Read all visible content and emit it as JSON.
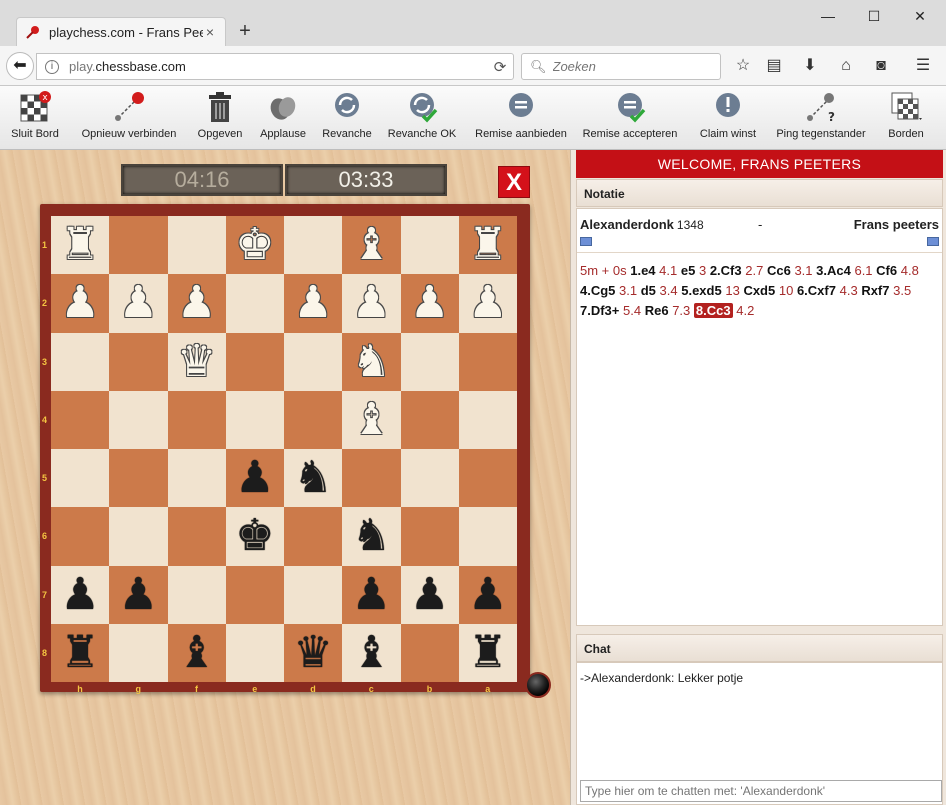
{
  "browser": {
    "tab_title": "playchess.com - Frans Pee...",
    "tab_close": "×",
    "new_tab": "+",
    "url_prefix": "play.",
    "url_host": "chessbase.com",
    "search_placeholder": "Zoeken",
    "window_controls": {
      "minimize": "—",
      "maximize": "☐",
      "close": "✕"
    }
  },
  "toolbar": {
    "items": [
      {
        "label": "Sluit Bord",
        "icon": "close-board-icon"
      },
      {
        "label": "Opnieuw verbinden",
        "icon": "reconnect-icon"
      },
      {
        "label": "Opgeven",
        "icon": "trash-icon"
      },
      {
        "label": "Applause",
        "icon": "applause-icon"
      },
      {
        "label": "Revanche",
        "icon": "rematch-icon"
      },
      {
        "label": "Revanche OK",
        "icon": "rematch-ok-icon"
      },
      {
        "label": "Remise aanbieden",
        "icon": "offer-draw-icon"
      },
      {
        "label": "Remise accepteren",
        "icon": "accept-draw-icon"
      },
      {
        "label": "Claim winst",
        "icon": "claim-win-icon"
      },
      {
        "label": "Ping tegenstander",
        "icon": "ping-icon"
      },
      {
        "label": "Borden",
        "icon": "boards-icon"
      }
    ]
  },
  "clocks": {
    "left": "04:16",
    "right": "03:33"
  },
  "resign_button": "X",
  "board": {
    "rank_labels": [
      "1",
      "2",
      "3",
      "4",
      "5",
      "6",
      "7",
      "8"
    ],
    "file_labels": [
      "h",
      "g",
      "f",
      "e",
      "d",
      "c",
      "b",
      "a"
    ],
    "rows": [
      [
        "♜",
        "",
        "",
        "♚",
        "",
        "♝",
        "",
        "♜"
      ],
      [
        "♟",
        "♟",
        "♟",
        "",
        "♟",
        "♟",
        "♟",
        "♟"
      ],
      [
        "",
        "",
        "♛",
        "",
        "",
        "♞",
        "",
        ""
      ],
      [
        "",
        "",
        "",
        "",
        "",
        "♝",
        "",
        ""
      ],
      [
        "",
        "",
        "",
        "♟",
        "♞",
        "",
        "",
        ""
      ],
      [
        "",
        "",
        "",
        "♚",
        "",
        "♞",
        "",
        ""
      ],
      [
        "♟",
        "♟",
        "",
        "",
        "",
        "♟",
        "♟",
        "♟"
      ],
      [
        "♜",
        "",
        "♝",
        "",
        "♛",
        "♝",
        "",
        "♜"
      ]
    ],
    "piece_colors": [
      [
        "w",
        "",
        "",
        "w",
        "",
        "w",
        "",
        "w"
      ],
      [
        "w",
        "w",
        "w",
        "",
        "w",
        "w",
        "w",
        "w"
      ],
      [
        "",
        "",
        "w",
        "",
        "",
        "w",
        "",
        ""
      ],
      [
        "",
        "",
        "",
        "",
        "",
        "w",
        "",
        ""
      ],
      [
        "",
        "",
        "",
        "b",
        "b",
        "",
        "",
        ""
      ],
      [
        "",
        "",
        "",
        "b",
        "",
        "b",
        "",
        ""
      ],
      [
        "b",
        "b",
        "",
        "",
        "",
        "b",
        "b",
        "b"
      ],
      [
        "b",
        "",
        "b",
        "",
        "b",
        "b",
        "",
        "b"
      ]
    ]
  },
  "panel": {
    "welcome": "WELCOME, FRANS PEETERS",
    "notation_header": "Notatie",
    "white_player": "Alexanderdonk",
    "white_elo": "1348",
    "separator": "-",
    "black_player": "Frans peeters",
    "moves": [
      {
        "t": "tm",
        "s": "5m + 0s"
      },
      {
        "t": "mv",
        "s": "1.e4"
      },
      {
        "t": "tm",
        "s": "4.1"
      },
      {
        "t": "mv",
        "s": "e5"
      },
      {
        "t": "tm",
        "s": "3"
      },
      {
        "t": "mv",
        "s": "2.Cf3"
      },
      {
        "t": "tm",
        "s": "2.7"
      },
      {
        "t": "mv",
        "s": "Cc6"
      },
      {
        "t": "tm",
        "s": "3.1"
      },
      {
        "t": "mv",
        "s": "3.Ac4"
      },
      {
        "t": "tm",
        "s": "6.1"
      },
      {
        "t": "mv",
        "s": "Cf6"
      },
      {
        "t": "tm",
        "s": "4.8"
      },
      {
        "t": "mv",
        "s": "4.Cg5"
      },
      {
        "t": "tm",
        "s": "3.1"
      },
      {
        "t": "mv",
        "s": "d5"
      },
      {
        "t": "tm",
        "s": "3.4"
      },
      {
        "t": "mv",
        "s": "5.exd5"
      },
      {
        "t": "tm",
        "s": "13"
      },
      {
        "t": "mv",
        "s": "Cxd5"
      },
      {
        "t": "tm",
        "s": "10"
      },
      {
        "t": "mv",
        "s": "6.Cxf7"
      },
      {
        "t": "tm",
        "s": "4.3"
      },
      {
        "t": "mv",
        "s": "Rxf7"
      },
      {
        "t": "tm",
        "s": "3.5"
      },
      {
        "t": "mv",
        "s": "7.Df3+"
      },
      {
        "t": "tm",
        "s": "5.4"
      },
      {
        "t": "mv",
        "s": "Re6"
      },
      {
        "t": "tm",
        "s": "7.3"
      },
      {
        "t": "cur",
        "s": "8.Cc3"
      },
      {
        "t": "tm",
        "s": "4.2"
      }
    ],
    "chat_header": "Chat",
    "chat_messages": [
      "->Alexanderdonk: Lekker potje"
    ],
    "chat_placeholder": "Type hier om te chatten met: 'Alexanderdonk'"
  },
  "colors": {
    "welcome_bg": "#c41016",
    "frame": "#8a2a1f",
    "dark_square": "#cc7a4a",
    "light_square": "#f1e3cf",
    "highlight_move": "#b3211f"
  }
}
